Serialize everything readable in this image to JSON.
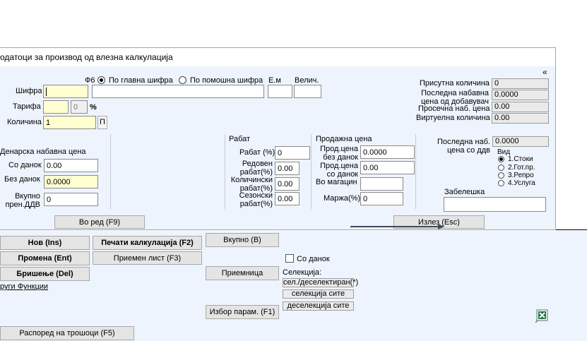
{
  "dialog": {
    "title": "одатоци за производ од влезна калкулација",
    "collapse_icon": "«",
    "radio_prefix": "Ф6",
    "radio_main": "По главна шифра",
    "radio_aux": "По помошна шифра",
    "em_label": "Е.м",
    "size_label": "Велич.",
    "shifra_label": "Шифра",
    "tarifa_label": "Тарифа",
    "tarifa_value": "",
    "tarifa_pct": "0",
    "pct_sign": "%",
    "kolicina_label": "Количина",
    "kolicina_value": "1",
    "p_button": "П",
    "price_section": "Денарска набавна цена",
    "so_danok_label": "Со данок",
    "so_danok_value": "0.00",
    "bez_danok_label": "Без данок",
    "bez_danok_value": "0.0000",
    "vkupno_label_1": "Вкупно",
    "vkupno_label_2": "прен.ДДВ",
    "vkupno_value": "0",
    "rabat_section": "Рабат",
    "rabat_pct_label": "Рабат (%)",
    "rabat_pct_value": "0",
    "reg_rabat_1": "Редовен",
    "reg_rabat_2": "рабат(%)",
    "reg_rabat_value": "0.00",
    "qty_rabat_1": "Количински",
    "qty_rabat_2": "рабат(%)",
    "qty_rabat_value": "0.00",
    "season_rabat_1": "Сезонски",
    "season_rabat_2": "рабат(%)",
    "season_rabat_value": "0.00",
    "sale_section": "Продажна цена",
    "sale_bez_1": "Прод.цена",
    "sale_bez_2": "без данок",
    "sale_bez_value": "0.0000",
    "sale_so_1": "Прод.цена",
    "sale_so_2": "со данок",
    "sale_so_value": "0.00",
    "vo_magacin_label": "Во магацин",
    "vo_magacin_value": "",
    "marza_label": "Маржа(%)",
    "marza_value": "0",
    "present_qty_label": "Присутна количина",
    "present_qty_value": "0",
    "last_price_1": "Последна набавна",
    "last_price_2": "цена од добавувач",
    "last_price_value": "0.0000",
    "avg_price_label": "Просечна наб. цена",
    "avg_price_value": "0.00",
    "virtual_qty_label": "Виртуелна количина",
    "virtual_qty_value": "0.00",
    "last_nab_1": "Последна наб.",
    "last_nab_2": "цена со ддв",
    "last_nab_value": "0.0000",
    "vid_label": "Вид",
    "vid_options": [
      "1.Стоки",
      "2.Гот.пр.",
      "3.Репро",
      "4.Услуга"
    ],
    "zabeleska_label": "Забелешка",
    "zabeleska_value": "",
    "ok_button": "Во ред (F9)",
    "exit_button": "Излез (Esc)"
  },
  "main": {
    "new_button": "Нов (Ins)",
    "edit_button": "Промена (Ent)",
    "delete_button": "Бришење (Del)",
    "other_link": "руги Функции",
    "print_button": "Печати калкулација (F2)",
    "receipt_button": "Приемен лист (F3)",
    "total_button": "Вкупно (B)",
    "priemnica_button": "Приемница",
    "params_button": "Избор парам. (F1)",
    "so_danok_checkbox": "Со данок",
    "selection_label": "Селекција:",
    "sel_toggle": "сел./деселектиран(*)",
    "sel_all": "селекција сите",
    "desel_all": "деселекција сите",
    "costs_button": "Распоред на трошоци (F5)",
    "excel_icon_color": "#217346"
  },
  "colors": {
    "dialog_bg": "#eef4fd",
    "highlight_input": "#ffffd0",
    "button_bg": "#e4e4e4"
  }
}
